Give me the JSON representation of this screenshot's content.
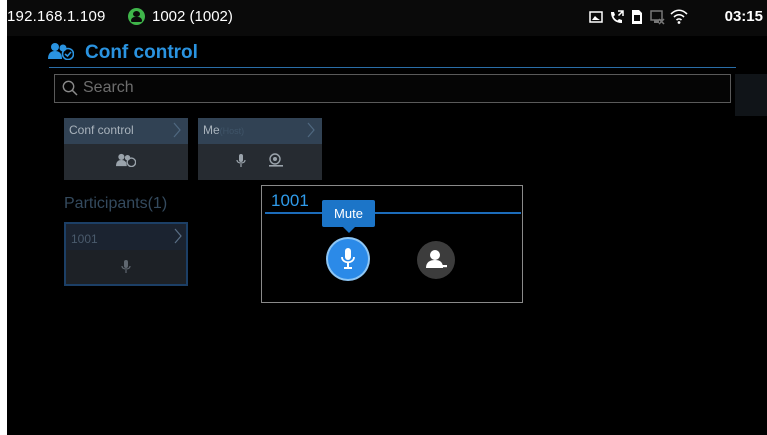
{
  "statusbar": {
    "ip": "192.168.1.109",
    "account": "1002 (1002)",
    "time": "03:15",
    "icons": [
      "image-icon",
      "call-forward-icon",
      "sim-card-icon",
      "ethernet-off-icon",
      "wifi-icon"
    ]
  },
  "header": {
    "title": "Conf control",
    "icon": "conference-icon"
  },
  "search": {
    "placeholder": "Search"
  },
  "tiles": [
    {
      "label": "Conf control",
      "icons": [
        "conference-icon"
      ]
    },
    {
      "label": "Me",
      "label_faded": "(Host)",
      "icons": [
        "microphone-icon",
        "camera-icon"
      ]
    }
  ],
  "participants": {
    "title": "Participants(1)",
    "items": [
      {
        "label": "1001",
        "icons": [
          "microphone-icon"
        ]
      }
    ]
  },
  "dialog": {
    "title": "1001",
    "tooltip": "Mute",
    "actions": [
      "mute-button",
      "remove-participant-button"
    ]
  },
  "colors": {
    "accent": "#2a93e0",
    "background": "#000000",
    "tooltip": "#1c75c8"
  }
}
